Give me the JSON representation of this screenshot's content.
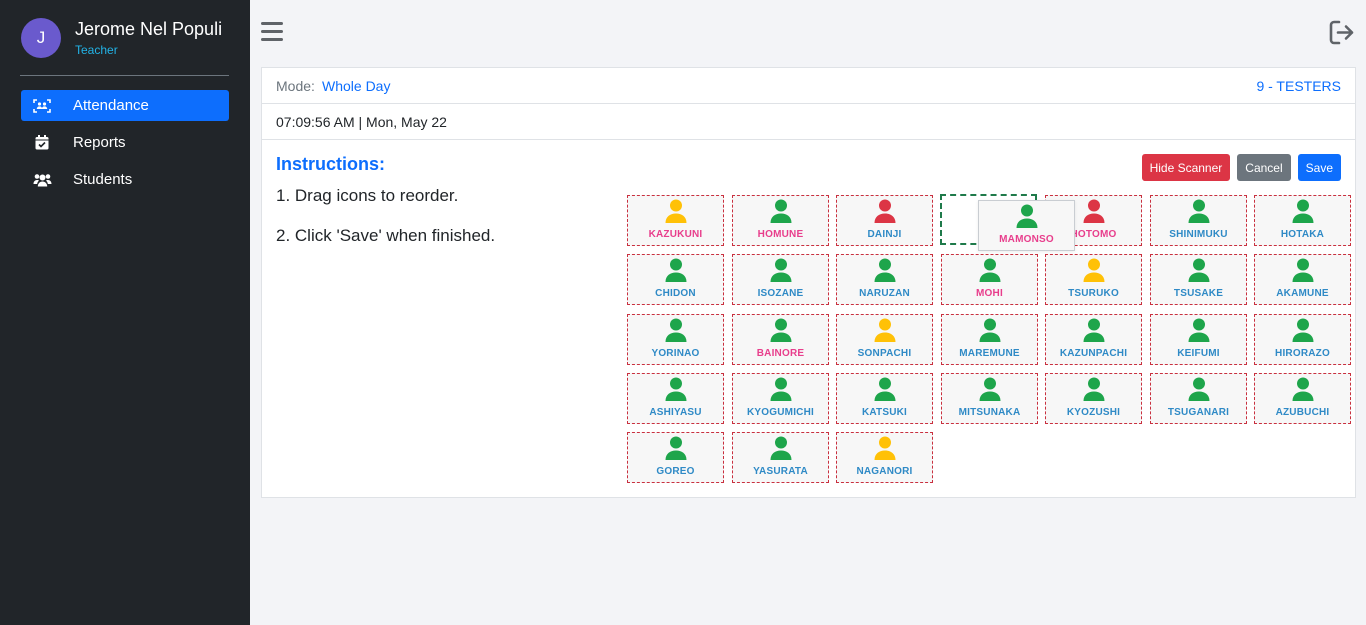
{
  "user": {
    "initial": "J",
    "name": "Jerome Nel Populi",
    "role": "Teacher"
  },
  "nav": [
    {
      "label": "Attendance",
      "icon": "scan-icon",
      "active": true
    },
    {
      "label": "Reports",
      "icon": "calendar-check-icon",
      "active": false
    },
    {
      "label": "Students",
      "icon": "users-icon",
      "active": false
    }
  ],
  "card": {
    "mode_label": "Mode:",
    "mode_value": "Whole Day",
    "class_name": "9 - TESTERS",
    "datetime": "07:09:56 AM | Mon, May 22"
  },
  "instructions": {
    "title": "Instructions:",
    "step1": "1. Drag icons to reorder.",
    "step2": "2. Click 'Save' when finished."
  },
  "buttons": {
    "hide_scanner": "Hide Scanner",
    "cancel": "Cancel",
    "save": "Save"
  },
  "colors": {
    "present": "#1ea54b",
    "late": "#ffc107",
    "absent": "#dc3545",
    "male": "#2f8ac6",
    "female": "#e83e8c"
  },
  "seats": [
    {
      "name": "KAZUKUNI",
      "status": "late",
      "gender": "female"
    },
    {
      "name": "HOMUNE",
      "status": "present",
      "gender": "female"
    },
    {
      "name": "DAINJI",
      "status": "absent",
      "gender": "male"
    },
    {
      "name": "",
      "status": "empty",
      "gender": ""
    },
    {
      "name": "HOTOMO",
      "status": "absent",
      "gender": "female"
    },
    {
      "name": "SHINIMUKU",
      "status": "present",
      "gender": "male"
    },
    {
      "name": "HOTAKA",
      "status": "present",
      "gender": "male"
    },
    {
      "name": "CHIDON",
      "status": "present",
      "gender": "male"
    },
    {
      "name": "ISOZANE",
      "status": "present",
      "gender": "male"
    },
    {
      "name": "NARUZAN",
      "status": "present",
      "gender": "male"
    },
    {
      "name": "MOHI",
      "status": "present",
      "gender": "female"
    },
    {
      "name": "TSURUKO",
      "status": "late",
      "gender": "male"
    },
    {
      "name": "TSUSAKE",
      "status": "present",
      "gender": "male"
    },
    {
      "name": "AKAMUNE",
      "status": "present",
      "gender": "male"
    },
    {
      "name": "YORINAO",
      "status": "present",
      "gender": "male"
    },
    {
      "name": "BAINORE",
      "status": "present",
      "gender": "female"
    },
    {
      "name": "SONPACHI",
      "status": "late",
      "gender": "male"
    },
    {
      "name": "MAREMUNE",
      "status": "present",
      "gender": "male"
    },
    {
      "name": "KAZUNPACHI",
      "status": "present",
      "gender": "male"
    },
    {
      "name": "KEIFUMI",
      "status": "present",
      "gender": "male"
    },
    {
      "name": "HIRORAZO",
      "status": "present",
      "gender": "male"
    },
    {
      "name": "ASHIYASU",
      "status": "present",
      "gender": "male"
    },
    {
      "name": "KYOGUMICHI",
      "status": "present",
      "gender": "male"
    },
    {
      "name": "KATSUKI",
      "status": "present",
      "gender": "male"
    },
    {
      "name": "MITSUNAKA",
      "status": "present",
      "gender": "male"
    },
    {
      "name": "KYOZUSHI",
      "status": "present",
      "gender": "male"
    },
    {
      "name": "TSUGANARI",
      "status": "present",
      "gender": "male"
    },
    {
      "name": "AZUBUCHI",
      "status": "present",
      "gender": "male"
    },
    {
      "name": "GOREO",
      "status": "present",
      "gender": "male"
    },
    {
      "name": "YASURATA",
      "status": "present",
      "gender": "male"
    },
    {
      "name": "NAGANORI",
      "status": "late",
      "gender": "male"
    }
  ],
  "dragging_seat": {
    "name": "MAMONSO",
    "status": "present",
    "gender": "female"
  }
}
